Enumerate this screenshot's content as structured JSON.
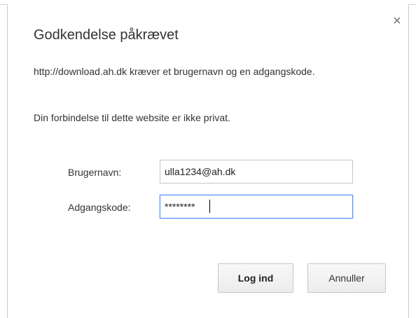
{
  "dialog": {
    "title": "Godkendelse påkrævet",
    "close_symbol": "×",
    "close_icon": "close-icon",
    "message": "http://download.ah.dk kræver et brugernavn og en adgangskode.",
    "privacy_notice": "Din forbindelse til dette website er ikke privat."
  },
  "form": {
    "username_label": "Brugernavn:",
    "username_value": "ulla1234@ah.dk",
    "password_label": "Adgangskode:",
    "password_value": "********"
  },
  "buttons": {
    "login_label": "Log ind",
    "cancel_label": "Annuller"
  },
  "colors": {
    "focus_border": "#4d90fe",
    "text": "#333333"
  }
}
